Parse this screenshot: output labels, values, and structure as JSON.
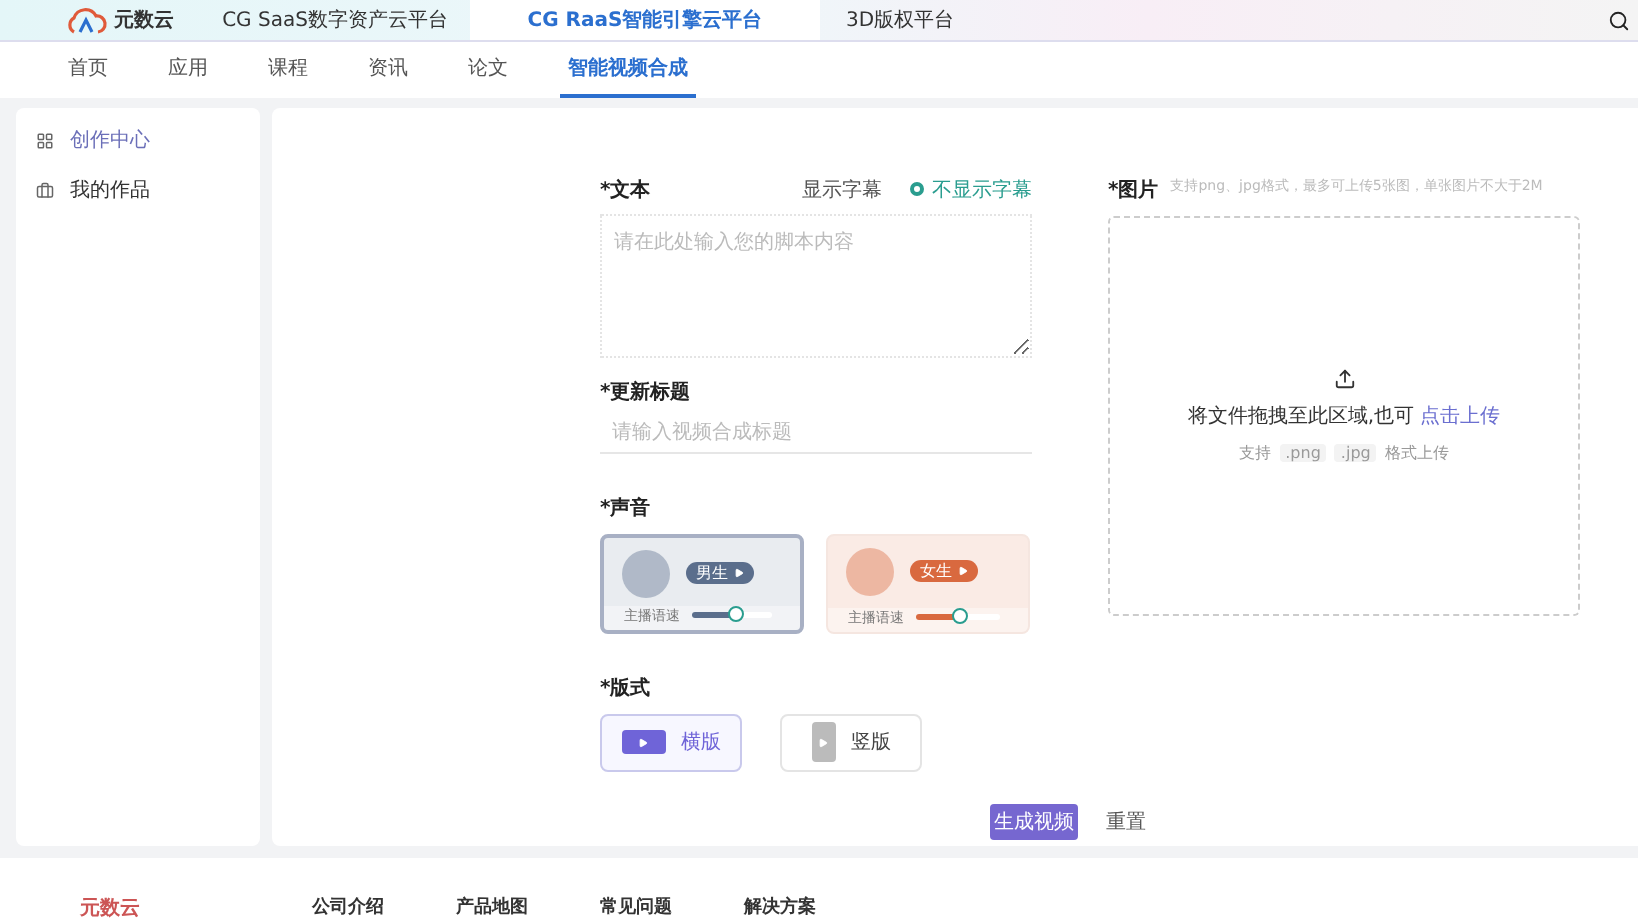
{
  "header": {
    "logo": "元数云",
    "platform_tabs": [
      {
        "label": "CG SaaS数字资产云平台",
        "selected": false
      },
      {
        "label": "CG RaaS智能引擎云平台",
        "selected": true
      },
      {
        "label": "3D版权平台",
        "selected": false
      }
    ]
  },
  "nav": [
    {
      "label": "首页",
      "selected": false
    },
    {
      "label": "应用",
      "selected": false
    },
    {
      "label": "课程",
      "selected": false
    },
    {
      "label": "资讯",
      "selected": false
    },
    {
      "label": "论文",
      "selected": false
    },
    {
      "label": "智能视频合成",
      "selected": true
    }
  ],
  "sidebar": {
    "items": [
      {
        "label": "创作中心",
        "kind": "grid",
        "selected": true
      },
      {
        "label": "我的作品",
        "kind": "folder",
        "selected": false
      }
    ]
  },
  "form": {
    "text": {
      "label": "*文本",
      "placeholder": "请在此处输入您的脚本内容",
      "subtitle_options": [
        {
          "label": "显示字幕",
          "selected": false
        },
        {
          "label": "不显示字幕",
          "selected": true
        }
      ]
    },
    "title": {
      "label": "*更新标题",
      "placeholder": "请输入视频合成标题"
    },
    "voice": {
      "label": "*声音",
      "options": [
        {
          "label": "男生",
          "speed_label": "主播语速",
          "level": 0.55,
          "selected": true,
          "color": "#5b6e8c"
        },
        {
          "label": "女生",
          "speed_label": "主播语速",
          "level": 0.52,
          "selected": false,
          "color": "#d9693f"
        }
      ]
    },
    "layout": {
      "label": "*版式",
      "options": [
        {
          "label": "横版",
          "kind": "landscape",
          "selected": true
        },
        {
          "label": "竖版",
          "kind": "portrait",
          "selected": false
        }
      ]
    },
    "image": {
      "label": "*图片",
      "hint": "支持png、jpg格式，最多可上传5张图，单张图片不大于2M",
      "drop_text": "将文件拖拽至此区域,也可",
      "upload_link": "点击上传",
      "support_prefix": "支持",
      "formats": [
        ".png",
        ".jpg"
      ],
      "support_suffix": "格式上传"
    },
    "buttons": {
      "primary": "生成视频",
      "secondary": "重置"
    }
  },
  "footer": {
    "logo": "元数云",
    "links": [
      "公司介绍",
      "产品地图",
      "常见问题",
      "解决方案"
    ]
  }
}
